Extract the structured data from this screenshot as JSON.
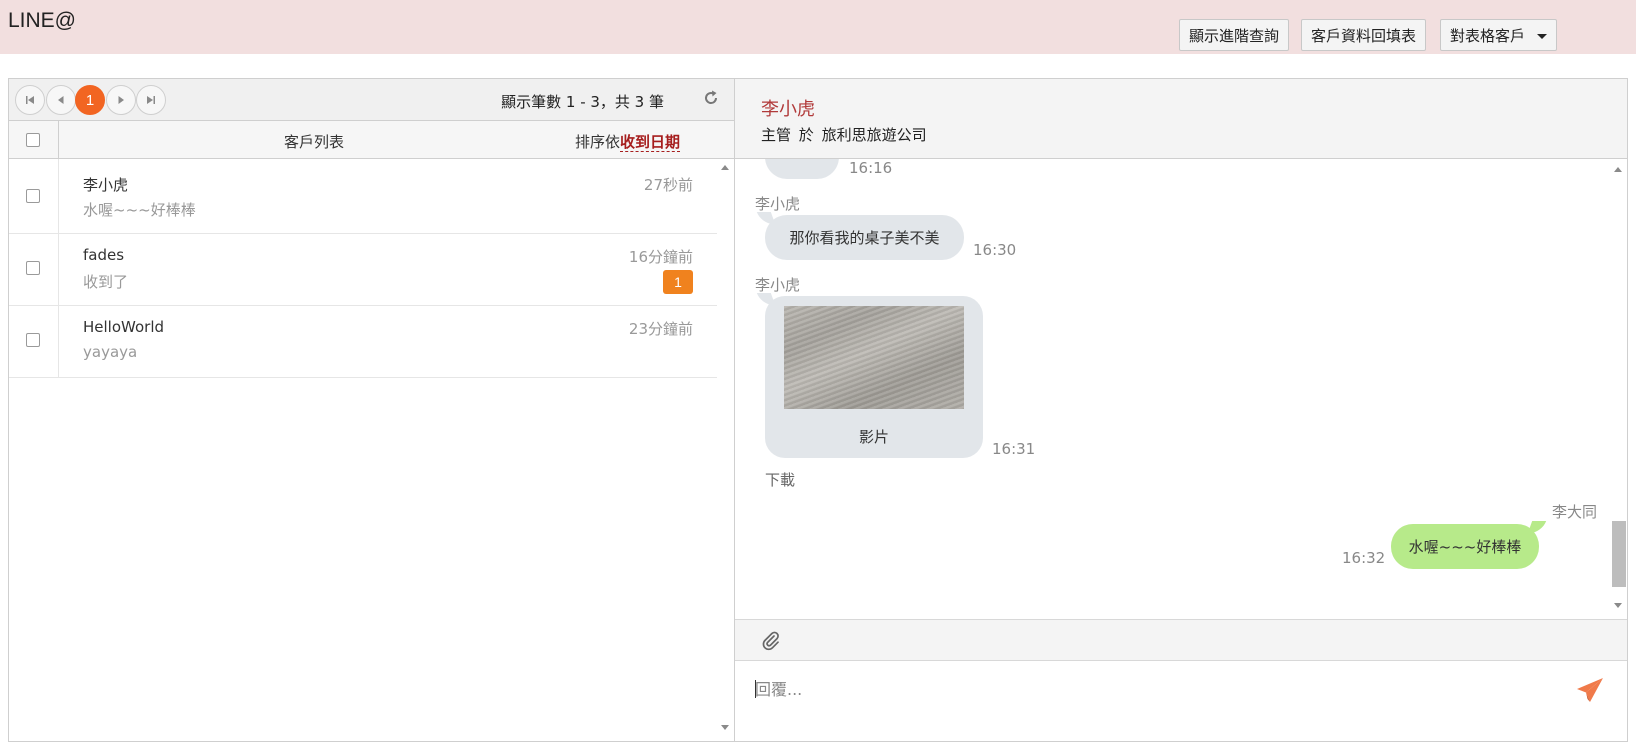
{
  "app": {
    "title": "LINE@"
  },
  "top_buttons": {
    "advanced_query": "顯示進階查詢",
    "customer_form": "客戶資料回填表",
    "target_customer": "對表格客戶"
  },
  "pager": {
    "current_page": "1",
    "info": "顯示筆數 1 - 3，共 3 筆"
  },
  "list_header": {
    "title": "客戶列表",
    "sort_prefix": "排序依",
    "sort_field": "收到日期"
  },
  "customers": [
    {
      "name": "李小虎",
      "message": "水喔~~~好棒棒",
      "time": "27秒前",
      "badge": ""
    },
    {
      "name": "fades",
      "message": "收到了",
      "time": "16分鐘前",
      "badge": "1"
    },
    {
      "name": "HelloWorld",
      "message": "yayaya",
      "time": "23分鐘前",
      "badge": ""
    }
  ],
  "chat": {
    "contact_name": "李小虎",
    "contact_role": "主管",
    "contact_at": "於",
    "contact_company": "旅利思旅遊公司",
    "partial_time": "16:16",
    "messages": [
      {
        "sender": "李小虎",
        "text": "那你看我的桌子美不美",
        "time": "16:30"
      },
      {
        "sender": "李小虎",
        "caption": "影片",
        "time": "16:31",
        "download": "下載"
      },
      {
        "sender": "李大同",
        "text": "水喔~~~好棒棒",
        "time": "16:32"
      }
    ],
    "reply_placeholder": "回覆..."
  },
  "icons": {
    "first_page": "first-page-icon",
    "prev_page": "prev-page-icon",
    "next_page": "next-page-icon",
    "last_page": "last-page-icon",
    "refresh": "refresh-icon",
    "attach": "paperclip-icon",
    "send": "send-icon"
  },
  "colors": {
    "topbar": "#f2dfdf",
    "accent": "#f26522",
    "badge": "#f0821e",
    "contact_name": "#b13a3a",
    "sort_field": "#a61e1e",
    "incoming_bubble": "#e2e6ea",
    "outgoing_bubble": "#b7ea8a",
    "send_icon": "#f07a4a"
  }
}
